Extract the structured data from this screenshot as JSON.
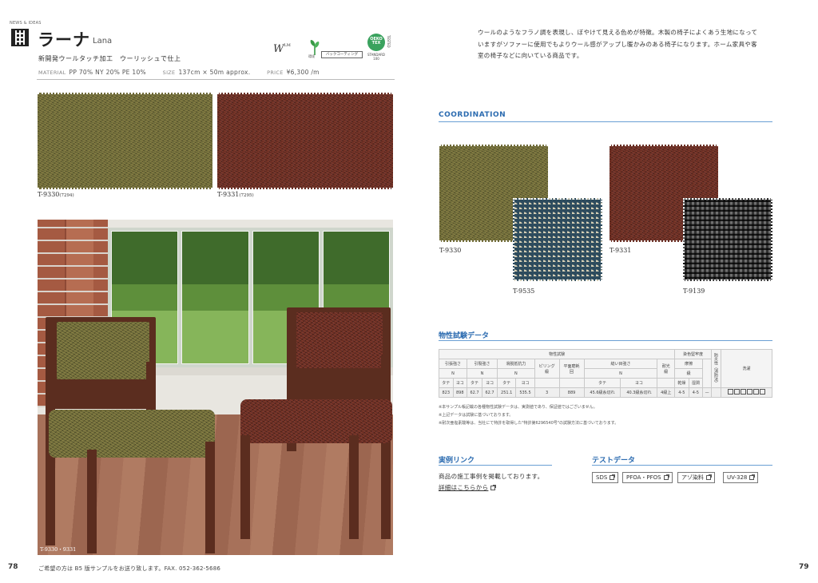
{
  "header": {
    "news_label": "NEWS & IDEAS",
    "product_name_jp": "ラーナ",
    "product_name_en": "Lana",
    "subtitle": "新開発ウールタッチ加工　ウーリッシュで仕上"
  },
  "logos": {
    "w_mark": "W",
    "w_mark_sub": "LM",
    "eco_label": "環境",
    "backing_label": "バックコーティング",
    "oeko_label": "OEKO TEX",
    "oeko_sub": "STANDARD 100",
    "oeko_vertical": "TESTED"
  },
  "spec": {
    "material_key": "MATERIAL",
    "material_value": "PP 70%  NY 20%  PE 10%",
    "size_key": "SIZE",
    "size_value": "137cm × 50m  approx.",
    "price_key": "PRICE",
    "price_value": "¥6,300 /m"
  },
  "swatches": [
    {
      "code": "T-9330",
      "number": "(7294)",
      "color": "green"
    },
    {
      "code": "T-9331",
      "number": "(7295)",
      "color": "red"
    }
  ],
  "photo": {
    "caption": "T-9330・9331"
  },
  "footer": {
    "page_left": "78",
    "note": "ご希望の方は B5 版サンプルをお送り致します。FAX. 052-362-5686",
    "page_right": "79"
  },
  "description": "ウールのようなフラノ調を表現し、ぼやけて見える色めが特徴。木製の椅子によくあう生地になっていますがソファーに使用でもよりウール感がアップし暖かみのある椅子になります。ホーム家具や客室の椅子などに向いている商品です。",
  "coordination": {
    "heading": "COORDINATION",
    "items": [
      {
        "main": "T-9330",
        "accent": "T-9535"
      },
      {
        "main": "T-9331",
        "accent": "T-9139"
      }
    ]
  },
  "properties": {
    "heading": "物性試験データ",
    "group_physical": "物性試験",
    "group_dye": "染色堅牢度",
    "vertical_label": "防炎性（消防法）",
    "care_label": "洗濯",
    "cols": {
      "tensile": "引張強さ",
      "tear": "引裂強さ",
      "slip": "滑脱抵抗力",
      "pilling": "ピリング",
      "abrasion": "平面磨耗",
      "seam": "縫い目強さ",
      "light": "耐光",
      "rub": "摩擦",
      "unit_n": "N",
      "unit_grade": "級",
      "unit_times": "回",
      "unit_grade2": "級",
      "tate": "タテ",
      "yoko": "ヨコ",
      "dry": "乾燥",
      "wet": "湿潤"
    },
    "values": [
      "823",
      "898",
      "62.7",
      "62.7",
      "251.1",
      "535.5",
      "3",
      "889",
      "45.6級糸切れ",
      "40.3級糸切れ",
      "4級上",
      "4-5",
      "4-5",
      "—"
    ],
    "notes": [
      "※本サンプル帳記載の各種物性試験データは、実測値であり、保証値ではございません。",
      "※上記データは試験に基づいております。",
      "※耐次亜塩素酸等は、当社にて特許を取得した\"特許第6296540号\"の試験方法に基づいております。"
    ]
  },
  "case_link": {
    "heading": "実例リンク",
    "text": "商品の施工事例を掲載しております。",
    "link": "詳細はこちらから"
  },
  "test_data": {
    "heading": "テストデータ",
    "buttons": [
      "SDS",
      "PFOA・PFOS",
      "アゾ染料",
      "UV-328"
    ]
  }
}
